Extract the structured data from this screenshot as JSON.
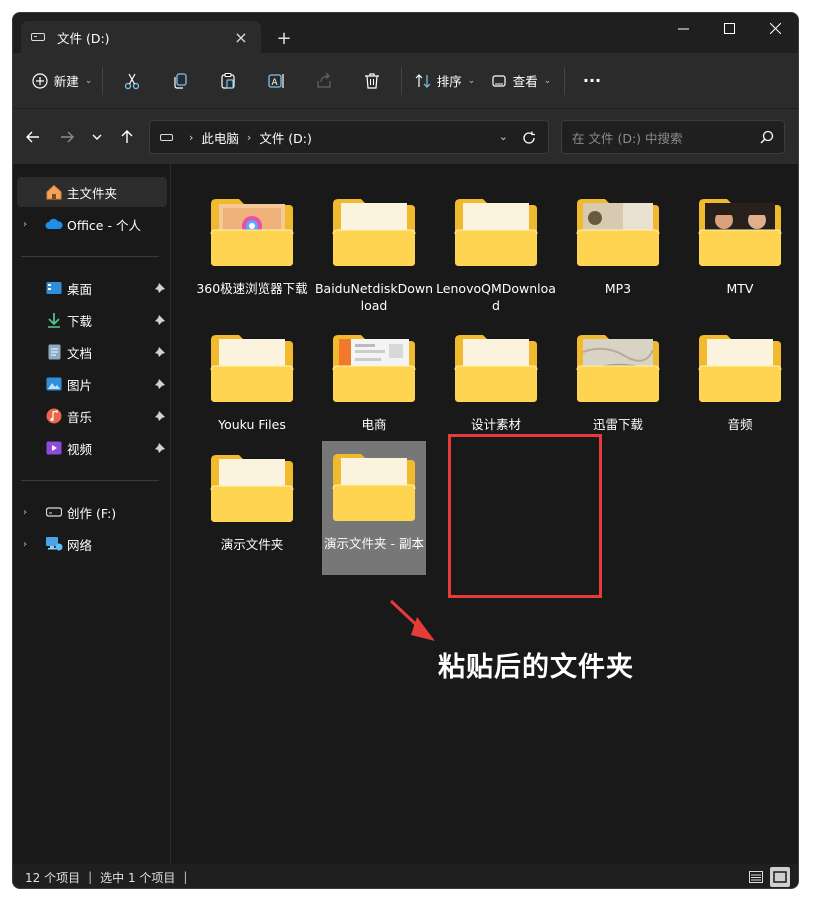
{
  "window": {
    "tab_title": "文件 (D:)",
    "new_tab_symbol": "+",
    "controls": {
      "minimize": "—",
      "maximize": "☐",
      "close": "✕"
    }
  },
  "toolbar": {
    "new_label": "新建",
    "sort_label": "排序",
    "view_label": "查看",
    "more_label": "···",
    "icons": [
      "cut-icon",
      "copy-icon",
      "paste-icon",
      "rename-icon",
      "share-icon",
      "delete-icon"
    ]
  },
  "address": {
    "crumbs": [
      "此电脑",
      "文件 (D:)"
    ],
    "search_placeholder": "在 文件 (D:) 中搜索"
  },
  "sidebar": {
    "home": "主文件夹",
    "cloud": "Office - 个人",
    "quick": [
      {
        "label": "桌面",
        "icon": "desktop-icon"
      },
      {
        "label": "下载",
        "icon": "download-icon"
      },
      {
        "label": "文档",
        "icon": "document-icon"
      },
      {
        "label": "图片",
        "icon": "picture-icon"
      },
      {
        "label": "音乐",
        "icon": "music-icon"
      },
      {
        "label": "视频",
        "icon": "video-icon"
      }
    ],
    "drive": "创作 (F:)",
    "network": "网络"
  },
  "folders": [
    {
      "name": "360极速浏览器下载",
      "thumb": "browser"
    },
    {
      "name": "BaiduNetdiskDownload",
      "thumb": "none"
    },
    {
      "name": "LenovoQMDownload",
      "thumb": "none"
    },
    {
      "name": "MP3",
      "thumb": "image"
    },
    {
      "name": "MTV",
      "thumb": "people"
    },
    {
      "name": "Youku Files",
      "thumb": "none"
    },
    {
      "name": "电商",
      "thumb": "doc"
    },
    {
      "name": "设计素材",
      "thumb": "none"
    },
    {
      "name": "迅雷下载",
      "thumb": "map"
    },
    {
      "name": "音频",
      "thumb": "none"
    },
    {
      "name": "演示文件夹",
      "thumb": "none"
    },
    {
      "name": "演示文件夹 - 副本",
      "thumb": "none",
      "selected": true
    }
  ],
  "annotation": {
    "text": "粘贴后的文件夹",
    "color": "#e63b3b"
  },
  "status": {
    "count": "12 个项目",
    "selected": "选中 1 个项目"
  },
  "colors": {
    "folder_front": "#ffd451",
    "folder_back": "#f0b92e",
    "selection": "#777777",
    "accent": "#4fc3f7"
  }
}
